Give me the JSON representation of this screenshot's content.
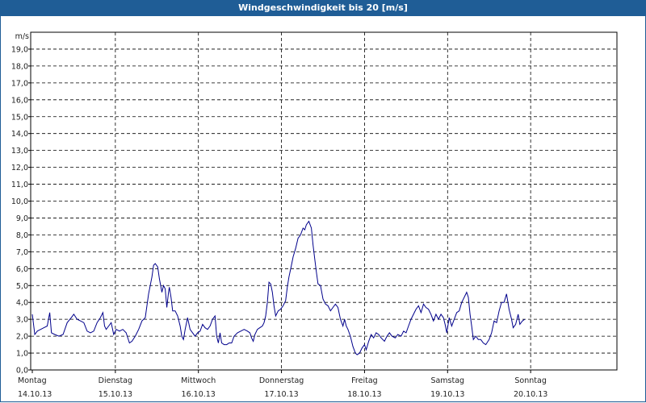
{
  "window": {
    "title": "Windgeschwindigkeit bis 20 [m/s]"
  },
  "colors": {
    "title_bg": "#1f5d96",
    "line": "#00008b",
    "grid": "#000000"
  },
  "chart_data": {
    "type": "line",
    "title": "Windgeschwindigkeit bis 20 [m/s]",
    "ylabel": "m/s",
    "ylim": [
      0,
      20
    ],
    "xlim": [
      0,
      7
    ],
    "grid": true,
    "yticks": [
      {
        "value": 0,
        "label": "0,0"
      },
      {
        "value": 1,
        "label": "1,0"
      },
      {
        "value": 2,
        "label": "2,0"
      },
      {
        "value": 3,
        "label": "3,0"
      },
      {
        "value": 4,
        "label": "4,0"
      },
      {
        "value": 5,
        "label": "5,0"
      },
      {
        "value": 6,
        "label": "6,0"
      },
      {
        "value": 7,
        "label": "7,0"
      },
      {
        "value": 8,
        "label": "8,0"
      },
      {
        "value": 9,
        "label": "9,0"
      },
      {
        "value": 10,
        "label": "10,0"
      },
      {
        "value": 11,
        "label": "11,0"
      },
      {
        "value": 12,
        "label": "12,0"
      },
      {
        "value": 13,
        "label": "13,0"
      },
      {
        "value": 14,
        "label": "14,0"
      },
      {
        "value": 15,
        "label": "15,0"
      },
      {
        "value": 16,
        "label": "16,0"
      },
      {
        "value": 17,
        "label": "17,0"
      },
      {
        "value": 18,
        "label": "18,0"
      },
      {
        "value": 19,
        "label": "19,0"
      }
    ],
    "xticks": [
      {
        "value": 0,
        "day": "Montag",
        "date": "14.10.13"
      },
      {
        "value": 1,
        "day": "Dienstag",
        "date": "15.10.13"
      },
      {
        "value": 2,
        "day": "Mittwoch",
        "date": "16.10.13"
      },
      {
        "value": 3,
        "day": "Donnerstag",
        "date": "17.10.13"
      },
      {
        "value": 4,
        "day": "Freitag",
        "date": "18.10.13"
      },
      {
        "value": 5,
        "day": "Samstag",
        "date": "19.10.13"
      },
      {
        "value": 6,
        "day": "Sonntag",
        "date": "20.10.13"
      }
    ],
    "series": [
      {
        "points": [
          [
            0.0,
            3.3
          ],
          [
            0.03,
            2.1
          ],
          [
            0.06,
            2.3
          ],
          [
            0.1,
            2.4
          ],
          [
            0.14,
            2.5
          ],
          [
            0.18,
            2.6
          ],
          [
            0.21,
            3.4
          ],
          [
            0.23,
            2.2
          ],
          [
            0.27,
            2.1
          ],
          [
            0.32,
            2.0
          ],
          [
            0.37,
            2.1
          ],
          [
            0.42,
            2.8
          ],
          [
            0.47,
            3.1
          ],
          [
            0.5,
            3.3
          ],
          [
            0.54,
            3.0
          ],
          [
            0.58,
            2.9
          ],
          [
            0.62,
            2.8
          ],
          [
            0.66,
            2.3
          ],
          [
            0.7,
            2.2
          ],
          [
            0.74,
            2.3
          ],
          [
            0.78,
            2.8
          ],
          [
            0.82,
            3.1
          ],
          [
            0.85,
            3.4
          ],
          [
            0.87,
            2.6
          ],
          [
            0.89,
            2.4
          ],
          [
            0.92,
            2.6
          ],
          [
            0.95,
            2.8
          ],
          [
            0.98,
            2.1
          ],
          [
            1.01,
            2.4
          ],
          [
            1.05,
            2.3
          ],
          [
            1.09,
            2.4
          ],
          [
            1.13,
            2.2
          ],
          [
            1.17,
            1.6
          ],
          [
            1.2,
            1.7
          ],
          [
            1.24,
            2.0
          ],
          [
            1.28,
            2.4
          ],
          [
            1.32,
            2.9
          ],
          [
            1.36,
            3.1
          ],
          [
            1.4,
            4.5
          ],
          [
            1.44,
            5.5
          ],
          [
            1.46,
            6.2
          ],
          [
            1.48,
            6.3
          ],
          [
            1.51,
            6.1
          ],
          [
            1.53,
            5.4
          ],
          [
            1.56,
            4.6
          ],
          [
            1.58,
            5.0
          ],
          [
            1.6,
            4.8
          ],
          [
            1.62,
            3.7
          ],
          [
            1.64,
            4.6
          ],
          [
            1.65,
            4.9
          ],
          [
            1.67,
            4.3
          ],
          [
            1.69,
            3.5
          ],
          [
            1.72,
            3.5
          ],
          [
            1.75,
            3.2
          ],
          [
            1.78,
            2.6
          ],
          [
            1.8,
            2.0
          ],
          [
            1.82,
            1.8
          ],
          [
            1.84,
            2.4
          ],
          [
            1.87,
            3.1
          ],
          [
            1.9,
            2.4
          ],
          [
            1.93,
            2.2
          ],
          [
            1.96,
            2.0
          ],
          [
            1.99,
            2.2
          ],
          [
            2.02,
            2.3
          ],
          [
            2.05,
            2.7
          ],
          [
            2.08,
            2.5
          ],
          [
            2.11,
            2.4
          ],
          [
            2.14,
            2.6
          ],
          [
            2.17,
            3.0
          ],
          [
            2.2,
            3.2
          ],
          [
            2.22,
            2.0
          ],
          [
            2.24,
            1.6
          ],
          [
            2.26,
            2.2
          ],
          [
            2.28,
            1.6
          ],
          [
            2.31,
            1.5
          ],
          [
            2.34,
            1.5
          ],
          [
            2.37,
            1.6
          ],
          [
            2.4,
            1.6
          ],
          [
            2.43,
            2.0
          ],
          [
            2.47,
            2.2
          ],
          [
            2.51,
            2.3
          ],
          [
            2.55,
            2.4
          ],
          [
            2.59,
            2.3
          ],
          [
            2.62,
            2.2
          ],
          [
            2.64,
            1.9
          ],
          [
            2.66,
            1.7
          ],
          [
            2.68,
            2.1
          ],
          [
            2.71,
            2.4
          ],
          [
            2.74,
            2.5
          ],
          [
            2.77,
            2.6
          ],
          [
            2.79,
            2.8
          ],
          [
            2.81,
            3.2
          ],
          [
            2.83,
            4.0
          ],
          [
            2.85,
            5.2
          ],
          [
            2.87,
            5.1
          ],
          [
            2.89,
            4.6
          ],
          [
            2.91,
            3.8
          ],
          [
            2.93,
            3.2
          ],
          [
            2.96,
            3.5
          ],
          [
            2.99,
            3.6
          ],
          [
            3.02,
            3.8
          ],
          [
            3.05,
            4.1
          ],
          [
            3.07,
            4.9
          ],
          [
            3.09,
            5.5
          ],
          [
            3.12,
            6.2
          ],
          [
            3.14,
            6.7
          ],
          [
            3.17,
            7.2
          ],
          [
            3.2,
            7.8
          ],
          [
            3.23,
            8.0
          ],
          [
            3.26,
            8.4
          ],
          [
            3.28,
            8.3
          ],
          [
            3.3,
            8.6
          ],
          [
            3.33,
            8.8
          ],
          [
            3.36,
            8.4
          ],
          [
            3.38,
            7.4
          ],
          [
            3.4,
            6.6
          ],
          [
            3.42,
            5.8
          ],
          [
            3.44,
            5.1
          ],
          [
            3.47,
            5.0
          ],
          [
            3.5,
            4.2
          ],
          [
            3.53,
            3.9
          ],
          [
            3.56,
            3.8
          ],
          [
            3.59,
            3.5
          ],
          [
            3.62,
            3.7
          ],
          [
            3.65,
            3.9
          ],
          [
            3.68,
            3.7
          ],
          [
            3.71,
            3.0
          ],
          [
            3.74,
            2.6
          ],
          [
            3.76,
            3.0
          ],
          [
            3.78,
            2.6
          ],
          [
            3.8,
            2.4
          ],
          [
            3.83,
            2.0
          ],
          [
            3.86,
            1.4
          ],
          [
            3.89,
            1.0
          ],
          [
            3.91,
            0.9
          ],
          [
            3.94,
            1.0
          ],
          [
            3.97,
            1.3
          ],
          [
            4.0,
            1.5
          ],
          [
            4.02,
            1.2
          ],
          [
            4.05,
            1.7
          ],
          [
            4.08,
            2.1
          ],
          [
            4.11,
            1.9
          ],
          [
            4.14,
            2.2
          ],
          [
            4.17,
            2.1
          ],
          [
            4.2,
            1.9
          ],
          [
            4.24,
            1.7
          ],
          [
            4.27,
            2.0
          ],
          [
            4.3,
            2.2
          ],
          [
            4.33,
            2.0
          ],
          [
            4.37,
            1.9
          ],
          [
            4.4,
            2.1
          ],
          [
            4.44,
            2.0
          ],
          [
            4.47,
            2.3
          ],
          [
            4.5,
            2.2
          ],
          [
            4.53,
            2.6
          ],
          [
            4.56,
            3.0
          ],
          [
            4.59,
            3.3
          ],
          [
            4.62,
            3.6
          ],
          [
            4.65,
            3.8
          ],
          [
            4.68,
            3.4
          ],
          [
            4.71,
            3.9
          ],
          [
            4.74,
            3.7
          ],
          [
            4.77,
            3.6
          ],
          [
            4.8,
            3.3
          ],
          [
            4.83,
            2.9
          ],
          [
            4.86,
            3.3
          ],
          [
            4.89,
            3.0
          ],
          [
            4.92,
            3.3
          ],
          [
            4.95,
            3.1
          ],
          [
            4.97,
            2.7
          ],
          [
            4.99,
            2.2
          ],
          [
            5.02,
            3.1
          ],
          [
            5.05,
            2.6
          ],
          [
            5.08,
            3.0
          ],
          [
            5.11,
            3.4
          ],
          [
            5.14,
            3.5
          ],
          [
            5.17,
            4.0
          ],
          [
            5.2,
            4.3
          ],
          [
            5.23,
            4.6
          ],
          [
            5.25,
            4.3
          ],
          [
            5.27,
            3.3
          ],
          [
            5.29,
            2.6
          ],
          [
            5.31,
            1.8
          ],
          [
            5.34,
            2.0
          ],
          [
            5.37,
            1.8
          ],
          [
            5.4,
            1.8
          ],
          [
            5.43,
            1.6
          ],
          [
            5.46,
            1.5
          ],
          [
            5.5,
            1.8
          ],
          [
            5.53,
            2.2
          ],
          [
            5.56,
            2.9
          ],
          [
            5.59,
            2.8
          ],
          [
            5.62,
            3.5
          ],
          [
            5.65,
            4.0
          ],
          [
            5.68,
            4.0
          ],
          [
            5.71,
            4.5
          ],
          [
            5.74,
            3.6
          ],
          [
            5.77,
            3.0
          ],
          [
            5.79,
            2.5
          ],
          [
            5.82,
            2.7
          ],
          [
            5.85,
            3.3
          ],
          [
            5.87,
            2.7
          ],
          [
            5.9,
            2.9
          ],
          [
            5.93,
            3.0
          ]
        ]
      }
    ]
  }
}
